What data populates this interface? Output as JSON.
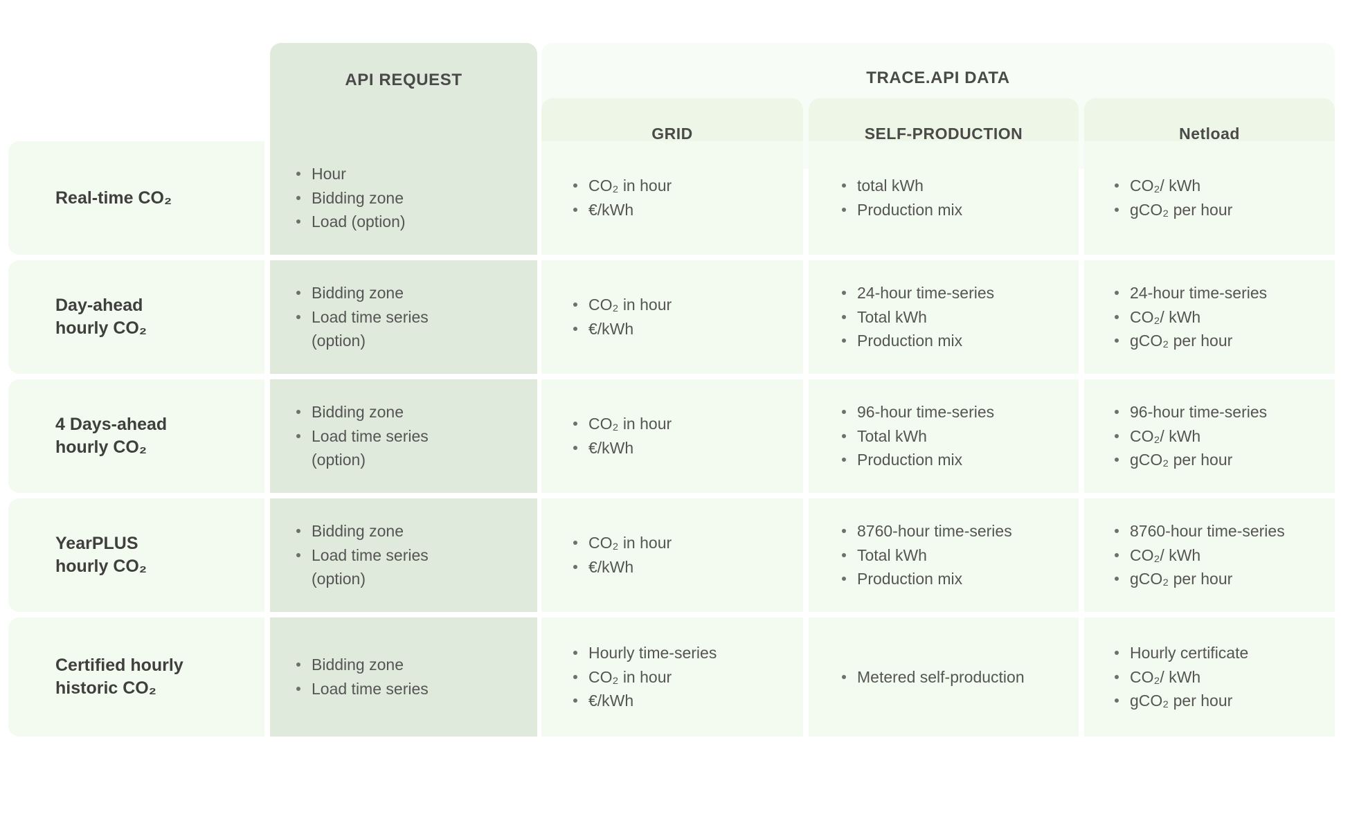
{
  "headers": {
    "api_request": "API REQUEST",
    "trace_api_data": "TRACE.API DATA",
    "grid": "GRID",
    "self_production": "SELF-PRODUCTION",
    "netload": "Netload"
  },
  "colors": {
    "page_bg": "#ffffff",
    "api_column": "#dfe9dc",
    "trace_group": "#f8fcf6",
    "sub_header": "#edf6e7",
    "cell": "#f3faef",
    "heading_text": "#4a4a48",
    "body_text": "#555553",
    "label_text": "#3f3f3d"
  },
  "rows": [
    {
      "label": "Real-time CO₂",
      "label_line1": "Real-time CO₂",
      "label_line2": "",
      "api_request": [
        "Hour",
        "Bidding zone",
        "Load (option)"
      ],
      "grid": [
        "CO₂ in hour",
        "€/kWh"
      ],
      "self_production": [
        "total kWh",
        "Production mix"
      ],
      "netload": [
        "CO₂/ kWh",
        "gCO₂ per hour"
      ]
    },
    {
      "label": "Day-ahead hourly CO₂",
      "label_line1": "Day-ahead",
      "label_line2": "hourly CO₂",
      "api_request": [
        "Bidding zone",
        "Load time series",
        "(option)"
      ],
      "grid": [
        "CO₂ in hour",
        "€/kWh"
      ],
      "self_production": [
        "24-hour time-series",
        "Total kWh",
        "Production mix"
      ],
      "netload": [
        "24-hour time-series",
        "CO₂/ kWh",
        "gCO₂ per hour"
      ]
    },
    {
      "label": "4 Days-ahead hourly CO₂",
      "label_line1": "4 Days-ahead",
      "label_line2": "hourly CO₂",
      "api_request": [
        "Bidding zone",
        "Load time series",
        "(option)"
      ],
      "grid": [
        "CO₂ in hour",
        "€/kWh"
      ],
      "self_production": [
        "96-hour time-series",
        "Total kWh",
        "Production mix"
      ],
      "netload": [
        "96-hour time-series",
        "CO₂/ kWh",
        "gCO₂ per hour"
      ]
    },
    {
      "label": "YearPLUS hourly CO₂",
      "label_line1": "YearPLUS",
      "label_line2": "hourly CO₂",
      "api_request": [
        "Bidding zone",
        "Load time series",
        "(option)"
      ],
      "grid": [
        "CO₂ in hour",
        "€/kWh"
      ],
      "self_production": [
        "8760-hour time-series",
        "Total kWh",
        "Production mix"
      ],
      "netload": [
        "8760-hour time-series",
        "CO₂/ kWh",
        "gCO₂ per hour"
      ]
    },
    {
      "label": "Certified hourly historic CO₂",
      "label_line1": "Certified hourly",
      "label_line2": "historic CO₂",
      "api_request": [
        "Bidding zone",
        "Load time series"
      ],
      "grid": [
        "Hourly time-series",
        "CO₂ in hour",
        "€/kWh"
      ],
      "self_production": [
        "Metered self-production"
      ],
      "netload": [
        "Hourly certificate",
        "CO₂/ kWh",
        "gCO₂ per hour"
      ]
    }
  ]
}
